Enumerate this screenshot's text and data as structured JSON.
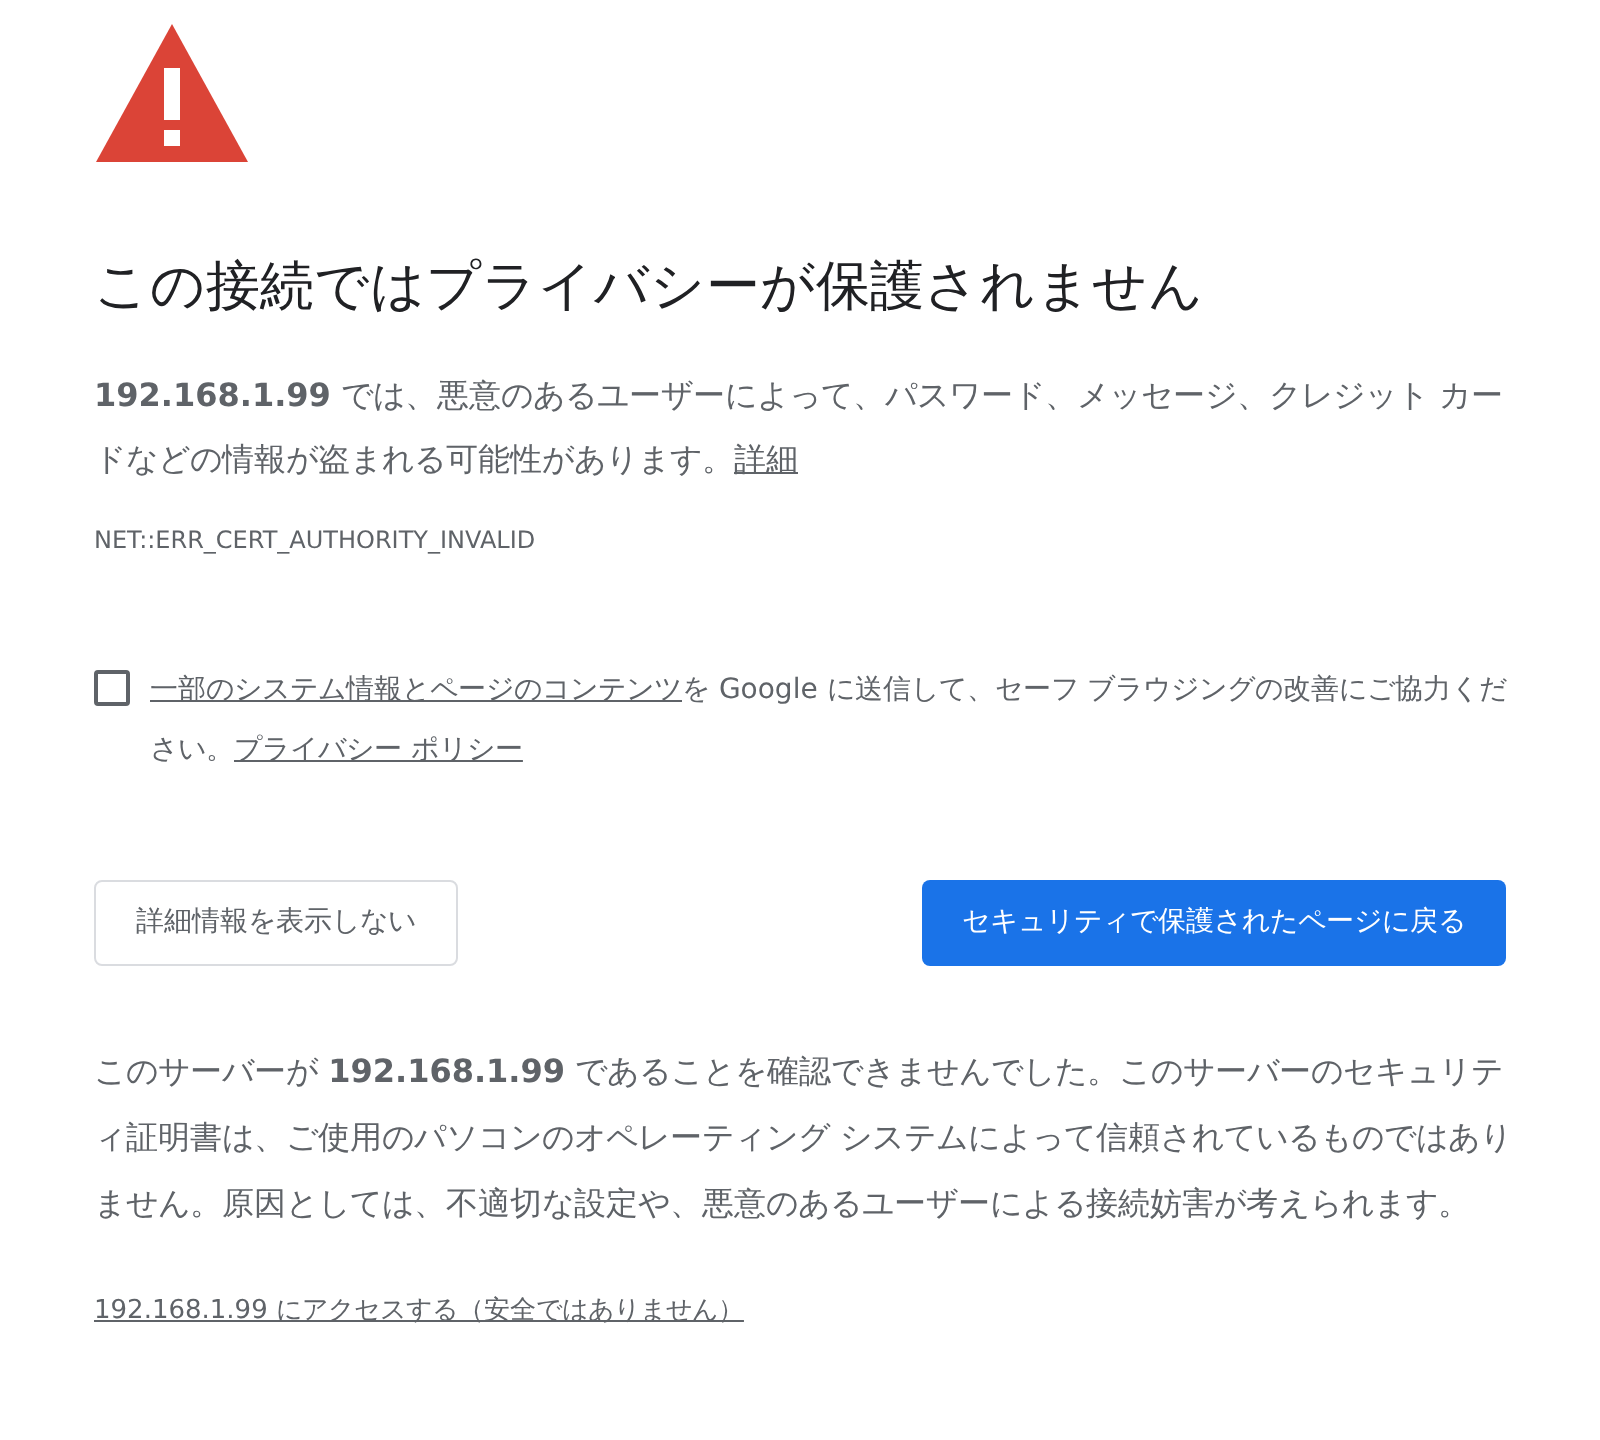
{
  "title": "この接続ではプライバシーが保護されません",
  "intro": {
    "text": "**192.168.1.99** では、悪意のあるユーザーによって、パスワード、メッセージ、クレジット カードなどの情報が盗まれる可能性があります。",
    "link": "詳細"
  },
  "error_code": "NET::ERR_CERT_AUTHORITY_INVALID",
  "report": {
    "checked": false,
    "link": "一部のシステム情報とページのコンテンツ",
    "text": "を Google に送信して、セーフ ブラウジングの改善にご協力ください。",
    "policy_link": "プライバシー ポリシー"
  },
  "buttons": [
    {
      "label": "詳細情報を表示しない",
      "kind": "secondary"
    },
    {
      "label": "セキュリティで保護されたページに戻る",
      "kind": "primary"
    }
  ],
  "details": "このサーバーが **192.168.1.99** であることを確認できませんでした。このサーバーのセキュリティ証明書は、ご使用のパソコンのオペレーティング システムによって信頼されているものではありません。原因としては、不適切な設定や、悪意のあるユーザーによる接続妨害が考えられます。",
  "proceed_link": "192.168.1.99 にアクセスする（安全ではありません）"
}
